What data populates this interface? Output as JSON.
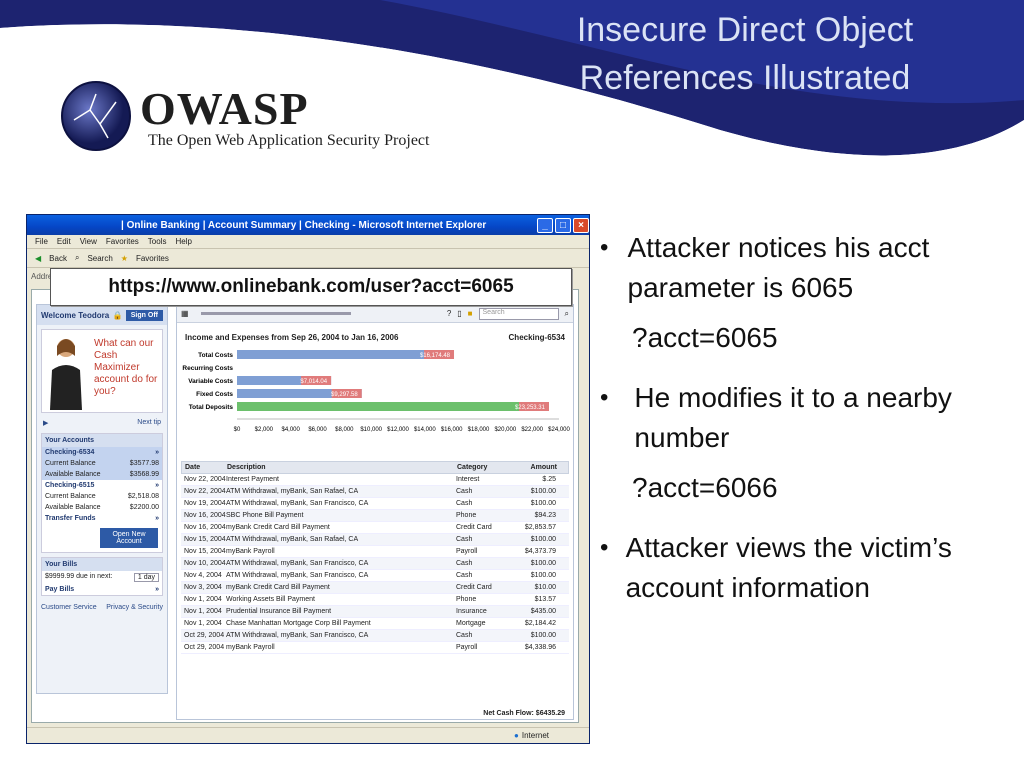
{
  "slide": {
    "title": "Insecure Direct Object References Illustrated",
    "logo_word": "OWASP",
    "logo_subtitle": "The Open Web Application Security Project",
    "url_callout": "https://www.onlinebank.com/user?acct=6065",
    "bullets": [
      {
        "text": "Attacker notices his acct parameter is 6065",
        "sub": "?acct=6065"
      },
      {
        "text": "He modifies it to a nearby number",
        "sub": "?acct=6066"
      },
      {
        "text": "Attacker views the victim’s account information",
        "sub": ""
      }
    ],
    "colors": {
      "swoosh": "#2a2f8c",
      "title": "#dbe3f5",
      "ie_titlebar": "#0546c6"
    }
  },
  "browser": {
    "window_title": "| Online Banking | Account Summary | Checking - Microsoft Internet Explorer",
    "menu": [
      "File",
      "Edit",
      "View",
      "Favorites",
      "Tools",
      "Help"
    ],
    "toolbar": [
      "Back",
      "Search",
      "Favorites"
    ],
    "address_label": "Addre",
    "status": "Internet"
  },
  "bank": {
    "welcome": "Welcome Teodora",
    "sign_off": "Sign Off",
    "promo": "What can our Cash Maximizer account do for you?",
    "next_tip": "Next tip",
    "your_accounts": "Your Accounts",
    "accounts": [
      {
        "name": "Checking-6534",
        "current_label": "Current Balance",
        "current": "$3577.98",
        "available_label": "Available Balance",
        "available": "$3568.99"
      },
      {
        "name": "Checking-6515",
        "current_label": "Current Balance",
        "current": "$2,518.08",
        "available_label": "Available Balance",
        "available": "$2200.00"
      }
    ],
    "transfer_funds": "Transfer Funds",
    "open_account": "Open New Account",
    "your_bills": "Your Bills",
    "bills_due": "$9999.99 due in next:",
    "bills_period": "1 day",
    "pay_bills": "Pay Bills",
    "customer_service": "Customer Service",
    "privacy": "Privacy & Security",
    "search_placeholder": "Search",
    "net_cash_flow": "Net Cash Flow: $6435.29"
  },
  "chart_data": {
    "type": "bar",
    "title": "Income and Expenses from Sep 26, 2004 to Jan 16, 2006",
    "account": "Checking-6534",
    "categories": [
      "Total Costs",
      "Recurring Costs",
      "Variable Costs",
      "Fixed Costs",
      "Total Deposits"
    ],
    "values": [
      16174.48,
      0,
      7014.04,
      9297.58,
      23253.31
    ],
    "labels": [
      "$16,174.48",
      "",
      "$7,014.04",
      "$9,297.58",
      "$23,253.31"
    ],
    "xticks": [
      "$0",
      "$2,000",
      "$4,000",
      "$6,000",
      "$8,000",
      "$10,000",
      "$12,000",
      "$14,000",
      "$16,000",
      "$18,000",
      "$20,000",
      "$22,000",
      "$24,000"
    ],
    "xlim": [
      0,
      24000
    ]
  },
  "transactions": {
    "headers": [
      "Date",
      "Description",
      "Category",
      "Amount"
    ],
    "rows": [
      [
        "Nov 22, 2004",
        "Interest Payment",
        "Interest",
        "$.25"
      ],
      [
        "Nov 22, 2004",
        "ATM Withdrawal, myBank, San Rafael, CA",
        "Cash",
        "$100.00"
      ],
      [
        "Nov 19, 2004",
        "ATM Withdrawal, myBank, San Francisco, CA",
        "Cash",
        "$100.00"
      ],
      [
        "Nov 16, 2004",
        "SBC Phone Bill Payment",
        "Phone",
        "$94.23"
      ],
      [
        "Nov 16, 2004",
        "myBank Credit Card Bill Payment",
        "Credit Card",
        "$2,853.57"
      ],
      [
        "Nov 15, 2004",
        "ATM Withdrawal, myBank, San Rafael, CA",
        "Cash",
        "$100.00"
      ],
      [
        "Nov 15, 2004",
        "myBank Payroll",
        "Payroll",
        "$4,373.79"
      ],
      [
        "Nov 10, 2004",
        "ATM Withdrawal, myBank, San Francisco, CA",
        "Cash",
        "$100.00"
      ],
      [
        "Nov 4, 2004",
        "ATM Withdrawal, myBank, San Francisco, CA",
        "Cash",
        "$100.00"
      ],
      [
        "Nov 3, 2004",
        "myBank Credit Card Bill Payment",
        "Credit Card",
        "$10.00"
      ],
      [
        "Nov 1, 2004",
        "Working Assets Bill Payment",
        "Phone",
        "$13.57"
      ],
      [
        "Nov 1, 2004",
        "Prudential Insurance Bill Payment",
        "Insurance",
        "$435.00"
      ],
      [
        "Nov 1, 2004",
        "Chase Manhattan Mortgage Corp Bill Payment",
        "Mortgage",
        "$2,184.42"
      ],
      [
        "Oct 29, 2004",
        "ATM Withdrawal, myBank, San Francisco, CA",
        "Cash",
        "$100.00"
      ],
      [
        "Oct 29, 2004",
        "myBank Payroll",
        "Payroll",
        "$4,338.96"
      ]
    ]
  }
}
